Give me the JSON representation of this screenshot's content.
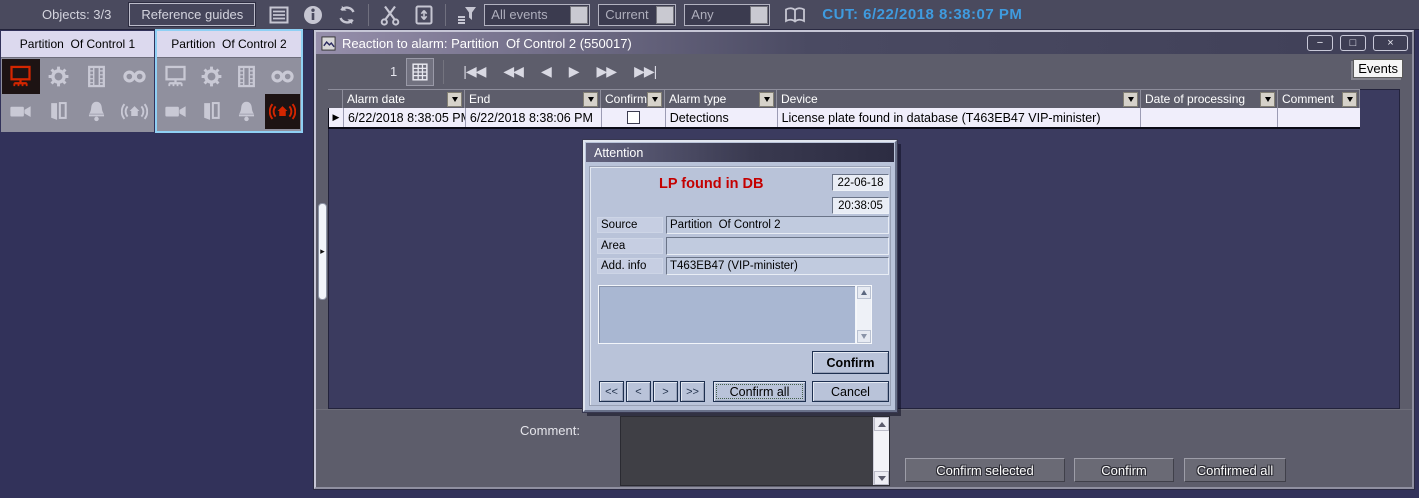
{
  "colors": {
    "accent_blue": "#3f9bdf",
    "alarm_red": "#d42600",
    "alert_text_red": "#c40000",
    "panel2_highlight_border": "#8fd0f4",
    "desktop": "#32325a",
    "window_chrome": "#5d5d6b",
    "dialog_bg": "#b9c3d9"
  },
  "topbar": {
    "objects_label": "Objects: 3/3",
    "reference_guides_button": "Reference guides",
    "filters": [
      "All events",
      "Current",
      "Any"
    ],
    "cut_label": "CUT: 6/22/2018 8:38:07 PM",
    "icons": [
      "list-icon",
      "info-icon",
      "refresh-icon",
      "cut-scissors-icon",
      "paste-icon",
      "filter-icon",
      "book-icon"
    ]
  },
  "panels": [
    {
      "title": "Partition  Of Control 1",
      "active_icon": "monitor-icon"
    },
    {
      "title": "Partition  Of Control 2",
      "active_icon": "siren-icon"
    }
  ],
  "panel_icons": [
    "monitor-icon",
    "gear-icon",
    "film-icon",
    "tape-recorder-icon",
    "camera-icon",
    "door-icon",
    "bell-icon",
    "siren-icon"
  ],
  "window": {
    "title": "Reaction to alarm: Partition  Of Control 2 (550017)",
    "controls": {
      "minimize": "−",
      "maximize": "□",
      "close": "×"
    },
    "events_button": "Events",
    "nav": {
      "page": "1",
      "first": "|◀◀",
      "fast_prev": "◀◀",
      "prev": "◀",
      "next": "▶",
      "fast_next": "▶▶",
      "last": "▶▶|"
    }
  },
  "table": {
    "columns": [
      "Alarm date",
      "End",
      "Confirm",
      "Alarm type",
      "Device",
      "Date of processing",
      "Comment"
    ],
    "row": {
      "marker": "▶",
      "alarm_date": "6/22/2018 8:38:05 PM",
      "end": "6/22/2018 8:38:06 PM",
      "confirm_checked": false,
      "alarm_type": "Detections",
      "device": "License plate found in database (T463EB47 VIP-minister)",
      "date_of_processing": "",
      "comment": ""
    }
  },
  "footer": {
    "comment_label": "Comment:",
    "comment_value": "",
    "buttons": {
      "confirm_selected": "Confirm selected",
      "confirm": "Confirm",
      "confirmed_all": "Confirmed all"
    }
  },
  "dialog": {
    "title": "Attention",
    "alert": "LP found in DB",
    "date": "22-06-18",
    "time": "20:38:05",
    "fields": [
      {
        "label": "Source",
        "value": "Partition  Of Control 2"
      },
      {
        "label": "Area",
        "value": ""
      },
      {
        "label": "Add. info",
        "value": "T463EB47 (VIP-minister)"
      }
    ],
    "message_value": "",
    "buttons": {
      "confirm": "Confirm",
      "nav": [
        "<<",
        "<",
        ">",
        ">>"
      ],
      "confirm_all": "Confirm all",
      "cancel": "Cancel"
    }
  }
}
